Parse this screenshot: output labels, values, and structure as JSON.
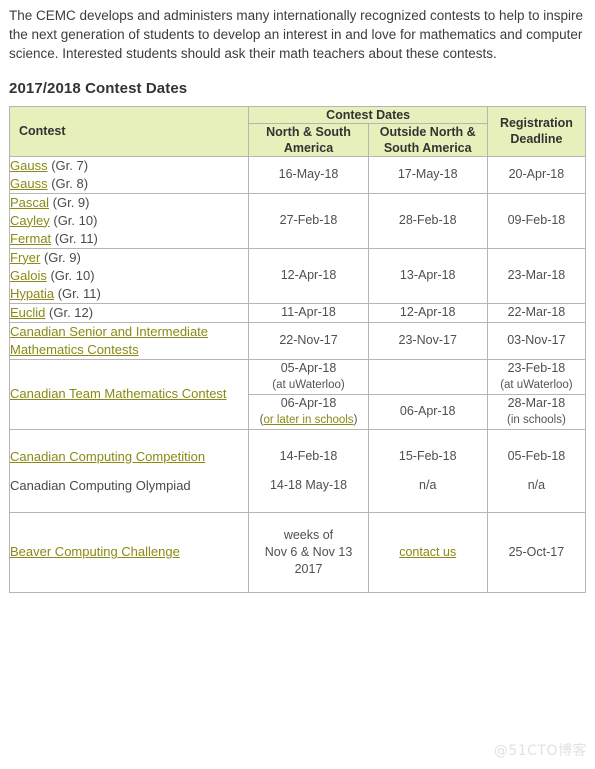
{
  "intro": {
    "paragraph": "The CEMC develops and administers many internationally recognized contests to help to inspire the next generation of students to develop an interest in and love for mathematics and computer science. Interested students should ask their math teachers about these contests."
  },
  "section": {
    "title": "2017/2018 Contest Dates"
  },
  "table": {
    "headers": {
      "contest": "Contest",
      "contest_dates": "Contest Dates",
      "north_south_america": "North & South America",
      "outside_north_south_america": "Outside North & South America",
      "registration_deadline": "Registration Deadline"
    },
    "rows": [
      {
        "names": [
          {
            "link": "Gauss",
            "suffix": " (Gr. 7)"
          },
          {
            "link": "Gauss",
            "suffix": " (Gr. 8)"
          }
        ],
        "americas": "16-May-18",
        "outside": "17-May-18",
        "deadline": "20-Apr-18"
      },
      {
        "names": [
          {
            "link": "Pascal",
            "suffix": " (Gr. 9)"
          },
          {
            "link": "Cayley",
            "suffix": " (Gr. 10)"
          },
          {
            "link": "Fermat",
            "suffix": " (Gr. 11)"
          }
        ],
        "americas": "27-Feb-18",
        "outside": "28-Feb-18",
        "deadline": "09-Feb-18"
      },
      {
        "names": [
          {
            "link": "Fryer",
            "suffix": " (Gr. 9)"
          },
          {
            "link": "Galois",
            "suffix": " (Gr. 10)"
          },
          {
            "link": "Hypatia",
            "suffix": " (Gr. 11)"
          }
        ],
        "americas": "12-Apr-18",
        "outside": "13-Apr-18",
        "deadline": "23-Mar-18"
      },
      {
        "names": [
          {
            "link": "Euclid",
            "suffix": " (Gr. 12)"
          }
        ],
        "americas": "11-Apr-18",
        "outside": "12-Apr-18",
        "deadline": "22-Mar-18"
      },
      {
        "names": [
          {
            "link": "Canadian Senior and Intermediate  Mathematics Contests",
            "suffix": ""
          }
        ],
        "americas": "22-Nov-17",
        "outside": "23-Nov-17",
        "deadline": "03-Nov-17"
      }
    ],
    "team_row": {
      "name_link": "Canadian Team Mathematics Contest",
      "sub_rows": [
        {
          "americas_main": "05-Apr-18",
          "americas_note": "(at uWaterloo)",
          "outside": "",
          "deadline_main": "23-Feb-18",
          "deadline_note": "(at uWaterloo)"
        },
        {
          "americas_main": "06-Apr-18",
          "americas_note_link": "or later in schools",
          "outside": "06-Apr-18",
          "deadline_main": "28-Mar-18",
          "deadline_note": "(in schools)"
        }
      ]
    },
    "computing_row": {
      "lines": [
        {
          "text": "Canadian Computing Competition",
          "is_link": true
        },
        {
          "text": "Canadian Computing Olympiad",
          "is_link": false
        }
      ],
      "americas": [
        "14-Feb-18",
        "14-18 May-18"
      ],
      "outside": [
        "15-Feb-18",
        "n/a"
      ],
      "deadline": [
        "05-Feb-18",
        "n/a"
      ]
    },
    "beaver_row": {
      "name_link": "Beaver Computing Challenge",
      "americas_lines": [
        "weeks of",
        "Nov 6 & Nov 13",
        "2017"
      ],
      "outside_link": "contact us",
      "deadline": "25-Oct-17"
    }
  },
  "watermark": "@51CTO博客",
  "colors": {
    "header_bg": "#e7efba",
    "border": "#b5b5b5",
    "link": "#8a8a14",
    "text": "#4a4a4a",
    "heading": "#333333"
  }
}
